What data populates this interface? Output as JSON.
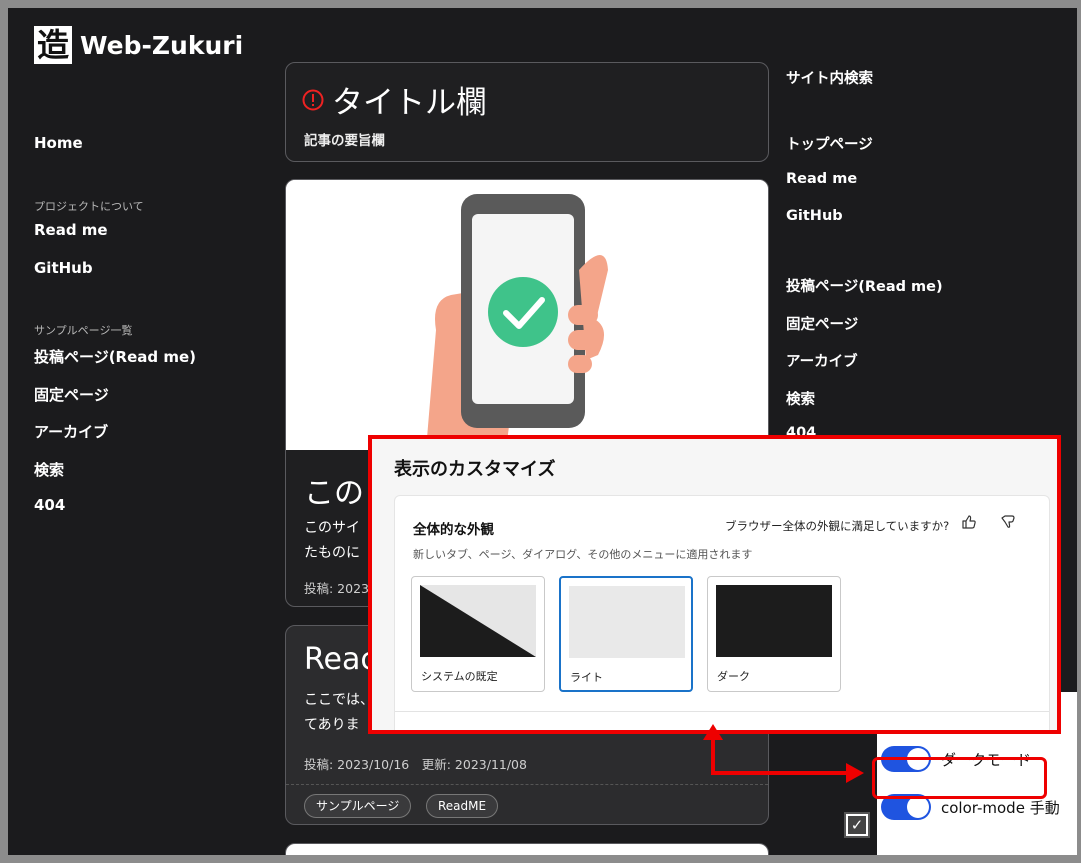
{
  "site": {
    "logo_char": "造",
    "name": "Web-Zukuri"
  },
  "left_nav": {
    "home": "Home",
    "section1_caption": "プロジェクトについて",
    "readme": "Read me",
    "github": "GitHub",
    "section2_caption": "サンプルページ一覧",
    "post_page": "投稿ページ(Read me)",
    "fixed_page": "固定ページ",
    "archive": "アーカイブ",
    "search": "検索",
    "notfound": "404"
  },
  "title_card": {
    "title": "タイトル欄",
    "summary": "記事の要旨欄"
  },
  "post1": {
    "title": "この",
    "excerpt_line1": "このサイ",
    "excerpt_line2": "たものに",
    "meta": "投稿: 2023/"
  },
  "post2": {
    "title": "Reac",
    "excerpt_line1": "ここでは、",
    "excerpt_line2": "てありま",
    "meta": "投稿: 2023/10/16　更新: 2023/11/08",
    "tags": [
      "サンプルページ",
      "ReadME"
    ]
  },
  "right_nav": {
    "site_search": "サイト内検索",
    "top_page": "トップページ",
    "readme": "Read me",
    "github": "GitHub",
    "post_page": "投稿ページ(Read me)",
    "fixed_page": "固定ページ",
    "archive": "アーカイブ",
    "search": "検索",
    "notfound": "404"
  },
  "dialog": {
    "title": "表示のカスタマイズ",
    "section_title": "全体的な外観",
    "description": "新しいタブ、ページ、ダイアログ、その他のメニューに適用されます",
    "feedback_question": "ブラウザー全体の外観に満足していますか?",
    "options": [
      "システムの既定",
      "ライト",
      "ダーク"
    ],
    "selected": "ライト"
  },
  "settings_panel": {
    "dark_mode_label": "ダークモード",
    "dark_mode_on": true,
    "color_mode_label": "color-mode 手動",
    "color_mode_on": true,
    "color_mode_checked": true
  },
  "colors": {
    "accent": "#1f54e0",
    "highlight": "#e00000",
    "selected_border": "#1a73c9",
    "success": "#3fc38a"
  }
}
